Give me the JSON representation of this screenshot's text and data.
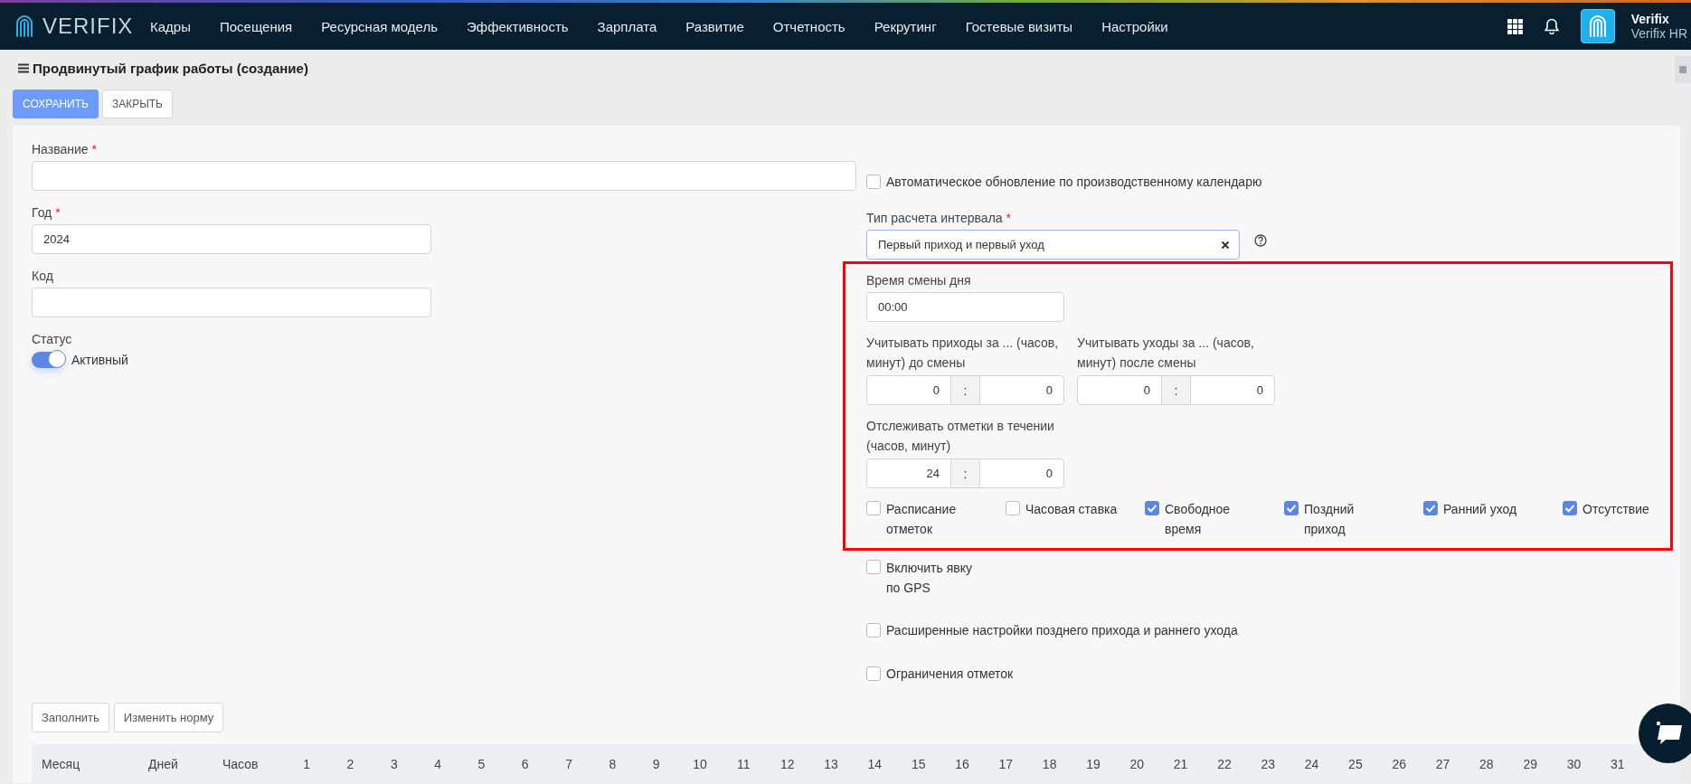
{
  "nav": {
    "logo": "VERIFIX",
    "items": [
      "Кадры",
      "Посещения",
      "Ресурсная модель",
      "Эффективность",
      "Зарплата",
      "Развитие",
      "Отчетность",
      "Рекрутинг",
      "Гостевые визиты",
      "Настройки"
    ],
    "user": {
      "name": "Verifix",
      "company": "Verifix HR"
    }
  },
  "page": {
    "title": "Продвинутый график работы (создание)",
    "buttons": [
      {
        "label": "СОХРАНИТЬ",
        "kind": "primary"
      },
      {
        "label": "ЗАКРЫТЬ",
        "kind": "plain"
      }
    ]
  },
  "left": [
    {
      "kind": "wide",
      "label": "Название",
      "required_mark": "*"
    },
    {
      "kind": "text",
      "label": "Год",
      "required_mark": "*",
      "value": "2024"
    },
    {
      "kind": "text",
      "label": "Код"
    },
    {
      "kind": "toggle",
      "label": "Статус",
      "on": true,
      "text": "Активный"
    }
  ],
  "right": [
    {
      "kind": "checkbox",
      "label": "Автоматическое обновление по производственному календарю",
      "checked": false
    },
    {
      "kind": "select",
      "label": "Тип расчета интервала",
      "required_mark": "*",
      "value": "Первый приход и первый уход"
    },
    {
      "kind": "panel",
      "children": [
        {
          "kind": "time",
          "label": "Время смены дня",
          "value": "00:00"
        },
        {
          "kind": "pairs",
          "pairs": [
            {
              "label": "Учитывать приходы за ... (часов, минут) до смены",
              "hours": "0",
              "separator": ":",
              "minutes": "0"
            },
            {
              "label": "Учитывать уходы за ... (часов, минут) после смены",
              "hours": "0",
              "separator": ":",
              "minutes": "0"
            }
          ]
        },
        {
          "kind": "pairs",
          "pairs": [
            {
              "label": "Отслеживать отметки в течении (часов, минут)",
              "hours": "24",
              "separator": ":",
              "minutes": "0"
            }
          ]
        },
        {
          "kind": "checks",
          "items": [
            {
              "label": "Расписание отметок",
              "checked": false
            },
            {
              "label": "Часовая ставка",
              "checked": false
            },
            {
              "label": "Свободное время",
              "checked": true
            },
            {
              "label": "Поздний приход",
              "checked": true
            },
            {
              "label": "Ранний уход",
              "checked": true
            },
            {
              "label": "Отсутствие",
              "checked": true
            }
          ]
        }
      ]
    },
    {
      "kind": "compact",
      "label": "Включить явку по GPS",
      "checked": false
    },
    {
      "kind": "checkbox",
      "label": "Расширенные настройки позднего прихода и раннего ухода",
      "checked": false
    },
    {
      "kind": "checkbox",
      "label": "Ограничения отметок",
      "checked": false
    }
  ],
  "actions": [
    "Заполнить",
    "Изменить норму"
  ],
  "table": {
    "columns": [
      "Месяц",
      "Дней",
      "Часов",
      "1",
      "2",
      "3",
      "4",
      "5",
      "6",
      "7",
      "8",
      "9",
      "10",
      "11",
      "12",
      "13",
      "14",
      "15",
      "16",
      "17",
      "18",
      "19",
      "20",
      "21",
      "22",
      "23",
      "24",
      "25",
      "26",
      "27",
      "28",
      "29",
      "30",
      "31"
    ]
  }
}
